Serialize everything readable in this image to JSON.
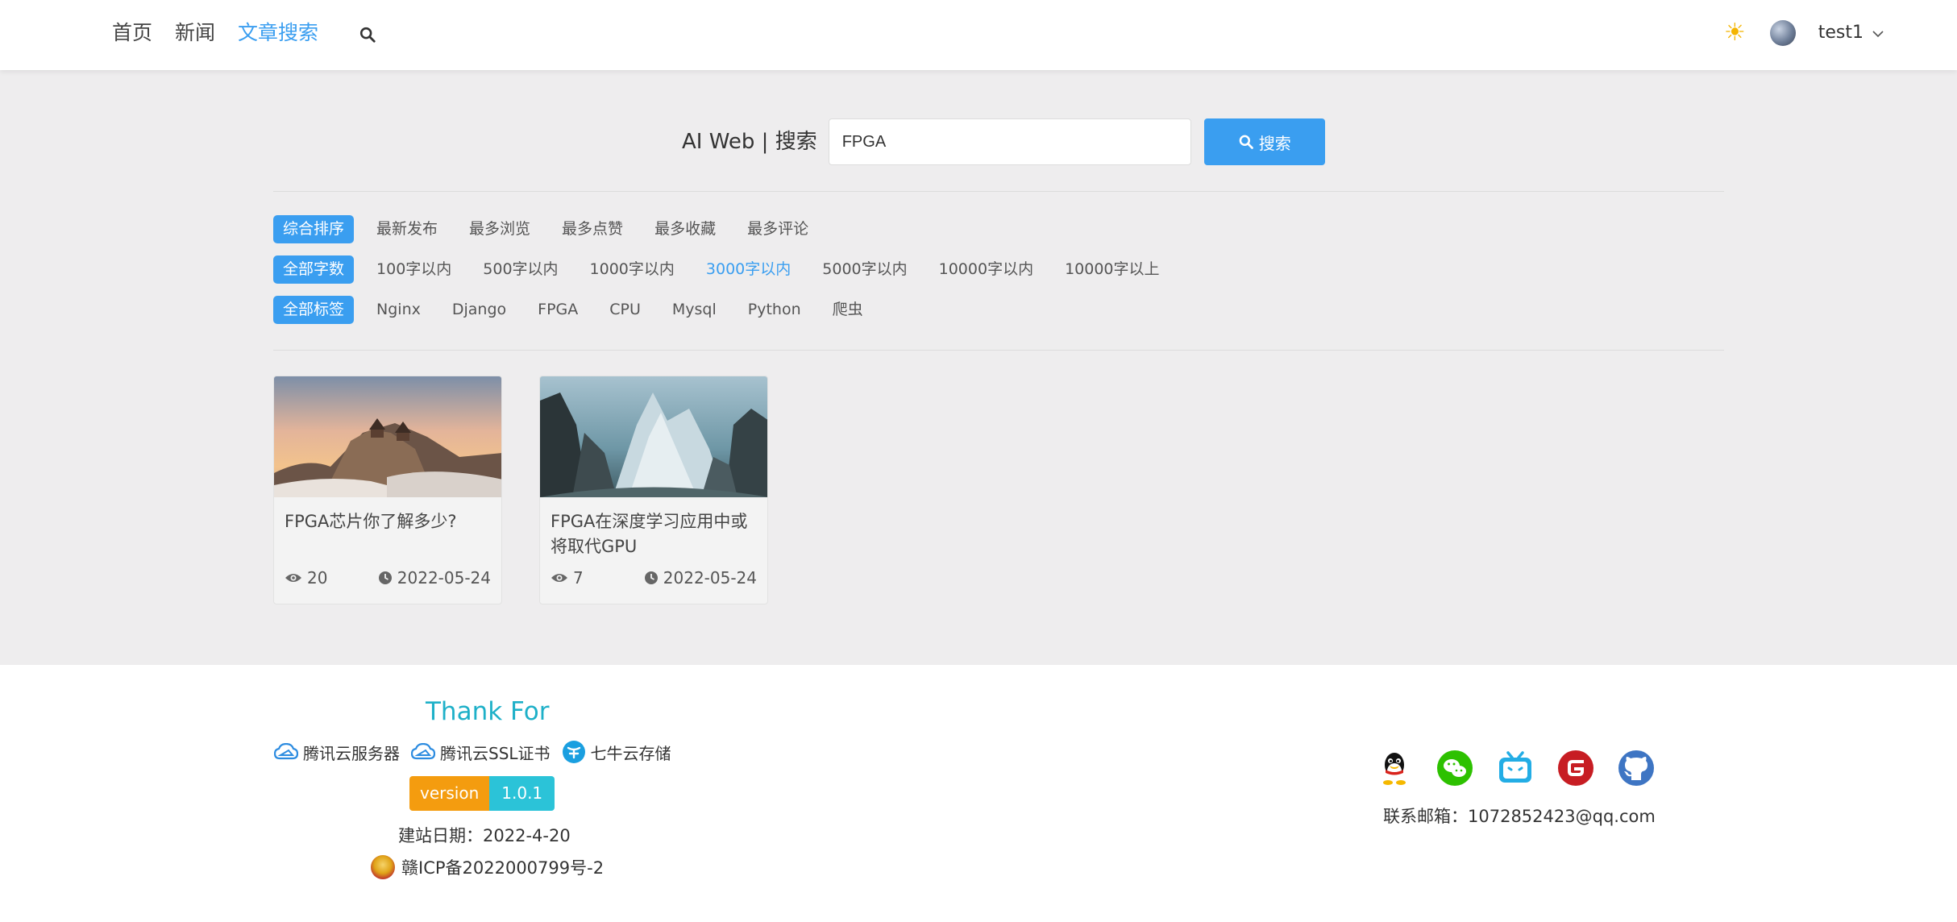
{
  "nav": {
    "items": [
      {
        "label": "首页",
        "active": false
      },
      {
        "label": "新闻",
        "active": false
      },
      {
        "label": "文章搜索",
        "active": true
      }
    ],
    "search_icon": "search-icon"
  },
  "user": {
    "theme_icon": "sun-icon",
    "name": "test1"
  },
  "search": {
    "brand": "AI Web | 搜索",
    "value": "FPGA",
    "button_label": "搜索"
  },
  "filters": {
    "sort": {
      "all": "综合排序",
      "options": [
        "最新发布",
        "最多浏览",
        "最多点赞",
        "最多收藏",
        "最多评论"
      ]
    },
    "length": {
      "all": "全部字数",
      "options": [
        "100字以内",
        "500字以内",
        "1000字以内",
        "3000字以内",
        "5000字以内",
        "10000字以内",
        "10000字以上"
      ],
      "selected_index": 3
    },
    "tags": {
      "all": "全部标签",
      "options": [
        "Nginx",
        "Django",
        "FPGA",
        "CPU",
        "Mysql",
        "Python",
        "爬虫"
      ]
    }
  },
  "articles": [
    {
      "title": "FPGA芯片你了解多少?",
      "views": "20",
      "date": "2022-05-24",
      "image": "temple-mountain-sunset"
    },
    {
      "title": "FPGA在深度学习应用中或将取代GPU",
      "views": "7",
      "date": "2022-05-24",
      "image": "fantasy-mountain-cliffs"
    }
  ],
  "footer": {
    "thanks": "Thank For",
    "sponsors": [
      {
        "label": "腾讯云服务器",
        "icon": "tencent-cloud-icon"
      },
      {
        "label": "腾讯云SSL证书",
        "icon": "tencent-cloud-icon"
      },
      {
        "label": "七牛云存储",
        "icon": "qiniu-icon"
      }
    ],
    "version_key": "version",
    "version_value": "1.0.1",
    "since": "建站日期：2022-4-20",
    "icp": "赣ICP备2022000799号-2",
    "socials": [
      "qq-icon",
      "wechat-icon",
      "bilibili-icon",
      "gitee-icon",
      "github-icon"
    ],
    "email": "联系邮箱：1072852423@qq.com"
  },
  "colors": {
    "accent": "#3a9ef0",
    "teal": "#1eb0c8",
    "version_key": "#f49c0f",
    "version_value": "#2bc3d8",
    "page_bg": "#eeedee"
  }
}
